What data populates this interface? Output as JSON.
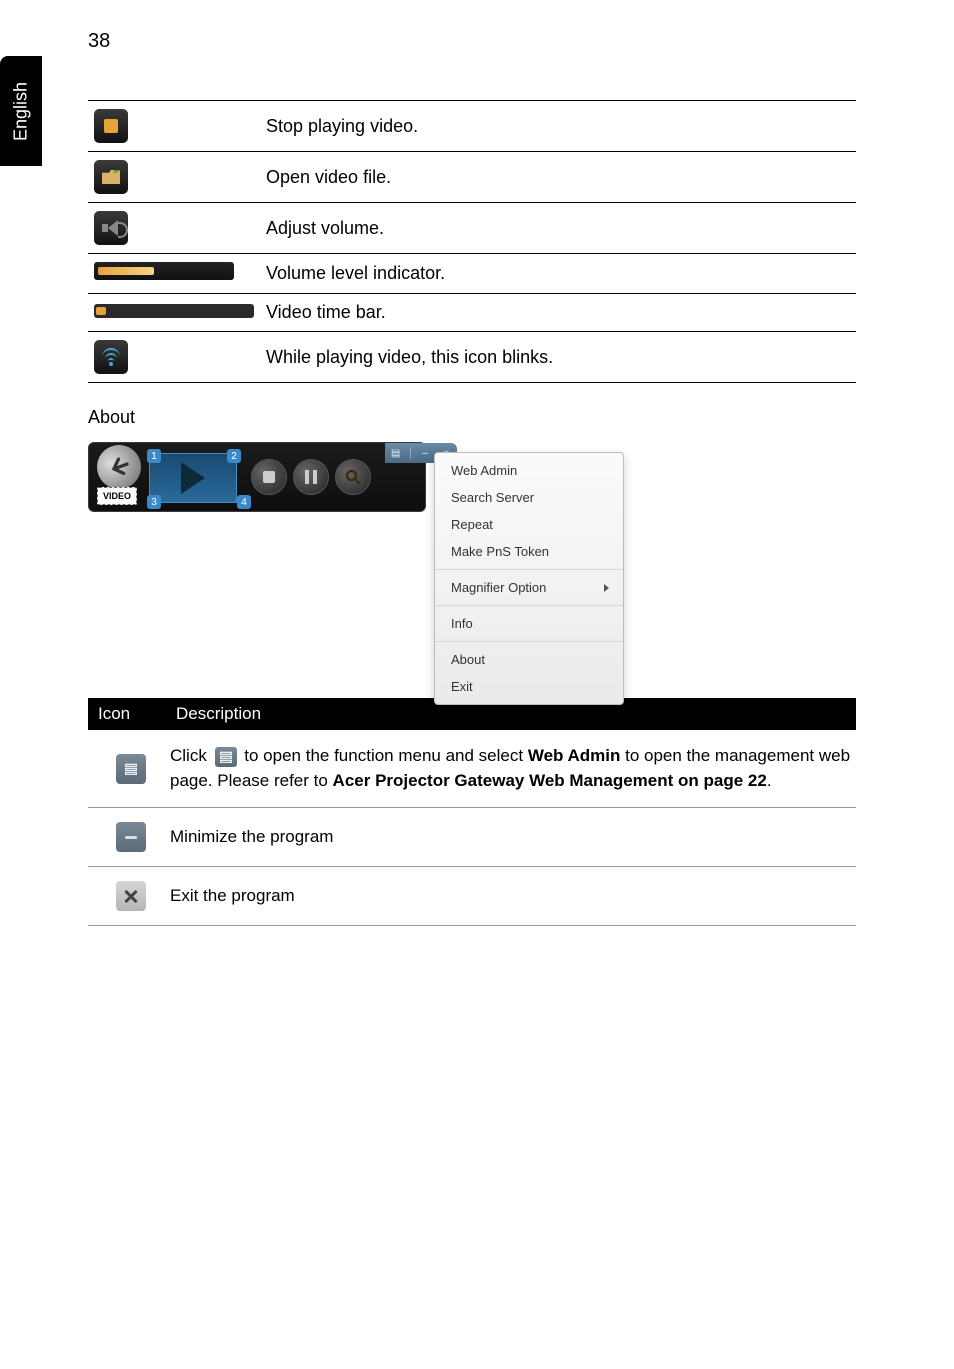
{
  "page": {
    "number": "38",
    "language_tab": "English"
  },
  "icon_table": [
    {
      "name": "stop-icon",
      "desc": "Stop playing video."
    },
    {
      "name": "open-file-icon",
      "desc": "Open video file."
    },
    {
      "name": "volume-icon",
      "desc": "Adjust volume."
    },
    {
      "name": "volume-bar",
      "desc": "Volume level indicator."
    },
    {
      "name": "time-bar",
      "desc": "Video time bar."
    },
    {
      "name": "wifi-icon",
      "desc": "While playing video, this icon blinks."
    }
  ],
  "about": {
    "heading": "About",
    "player": {
      "video_label": "VIDEO",
      "badges": [
        "1",
        "2",
        "3",
        "4"
      ]
    },
    "titlebar": {
      "menu_glyph": "▤",
      "minimize_glyph": "–",
      "close_glyph": "×"
    },
    "menu": {
      "groups": [
        {
          "items": [
            {
              "label": "Web Admin"
            },
            {
              "label": "Search Server"
            },
            {
              "label": "Repeat"
            },
            {
              "label": "Make PnS Token"
            }
          ]
        },
        {
          "items": [
            {
              "label": "Magnifier Option",
              "submenu": true
            }
          ]
        },
        {
          "items": [
            {
              "label": "Info"
            }
          ]
        },
        {
          "items": [
            {
              "label": "About"
            },
            {
              "label": "Exit"
            }
          ]
        }
      ]
    }
  },
  "desc_table": {
    "header": {
      "icon": "Icon",
      "description": "Description"
    },
    "rows": [
      {
        "iconkey": "menu",
        "pre": " Click ",
        "mid": " to open the function menu and select ",
        "bold1": "Web Admin",
        "post1": " to open the management web page. Please refer to ",
        "bold2": "Acer Projector Gateway Web Management on page 22",
        "tail": "."
      },
      {
        "iconkey": "min",
        "text": "Minimize the program"
      },
      {
        "iconkey": "close",
        "text": "Exit the program"
      }
    ]
  }
}
